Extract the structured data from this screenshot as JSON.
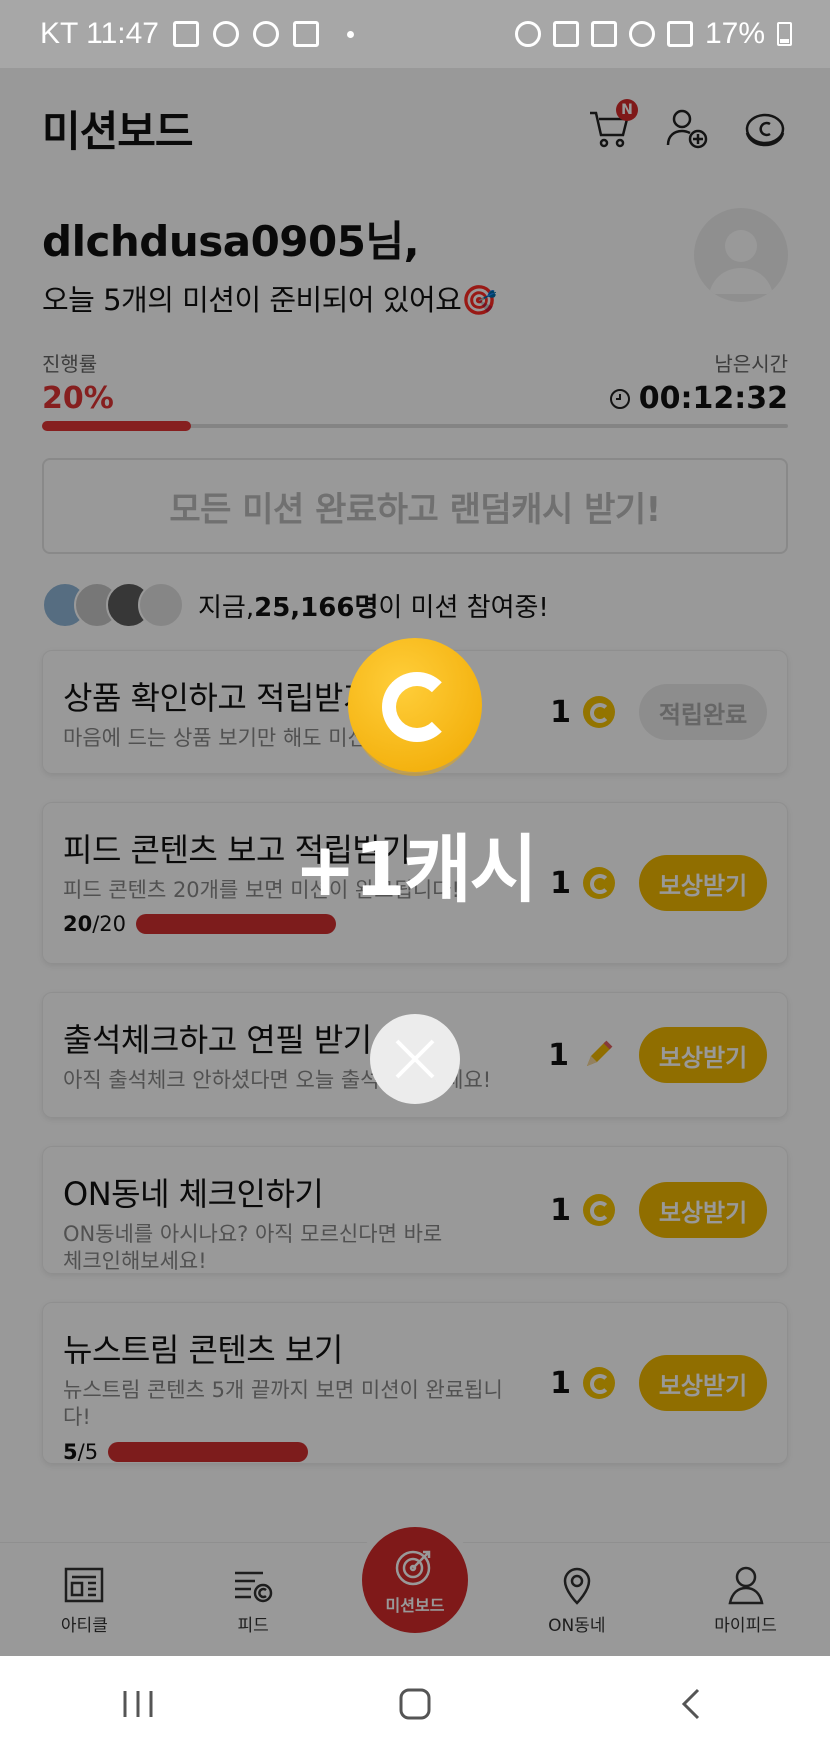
{
  "status_bar": {
    "carrier_time": "KT 11:47",
    "battery": "17%"
  },
  "header": {
    "title": "미션보드",
    "cart_badge": "N"
  },
  "greeting": {
    "name": "dlchdusa0905님,",
    "subtitle": "오늘 5개의 미션이 준비되어 있어요🎯"
  },
  "progress": {
    "label": "진행률",
    "value": "20%",
    "fraction": 0.2,
    "remain_label": "남은시간",
    "remain_time": "00:12:32"
  },
  "all_complete_button": "모든 미션 완료하고 랜덤캐시 받기!",
  "participants": {
    "prefix": "지금, ",
    "count": "25,166명",
    "suffix": "이 미션 참여중!"
  },
  "missions": [
    {
      "title": "상품 확인하고 적립받기",
      "desc": "마음에 드는 상품 보기만 해도 미션 완료!",
      "reward": "1",
      "reward_icon": "coin-icon",
      "button": "적립완료",
      "done": true
    },
    {
      "title": "피드 콘텐츠 보고 적립받기",
      "desc": "피드 콘텐츠 20개를 보면 미션이 완료됩니다!",
      "progress_done": "20",
      "progress_total": "/20",
      "reward": "1",
      "reward_icon": "coin-icon",
      "button": "보상받기"
    },
    {
      "title": "출석체크하고 연필 받기",
      "desc": "아직 출석체크 안하셨다면 오늘 출석체크 하세요!",
      "reward": "1",
      "reward_icon": "pencil-icon",
      "button": "보상받기"
    },
    {
      "title": "ON동네 체크인하기",
      "desc": "ON동네를 아시나요? 아직 모르신다면 바로 체크인해보세요!",
      "reward": "1",
      "reward_icon": "coin-icon",
      "button": "보상받기"
    },
    {
      "title": "뉴스트림 콘텐츠 보기",
      "desc": "뉴스트림 콘텐츠 5개 끝까지 보면 미션이 완료됩니다!",
      "progress_done": "5",
      "progress_total": "/5",
      "reward": "1",
      "reward_icon": "coin-icon",
      "button": "보상받기"
    }
  ],
  "bottom_nav": {
    "article": "아티클",
    "feed": "피드",
    "mission": "미션보드",
    "on": "ON동네",
    "my": "마이피드"
  },
  "popup": {
    "reward_text": "+1캐시"
  },
  "colors": {
    "accent_red": "#d42b2b",
    "reward_yellow": "#f0b800"
  }
}
